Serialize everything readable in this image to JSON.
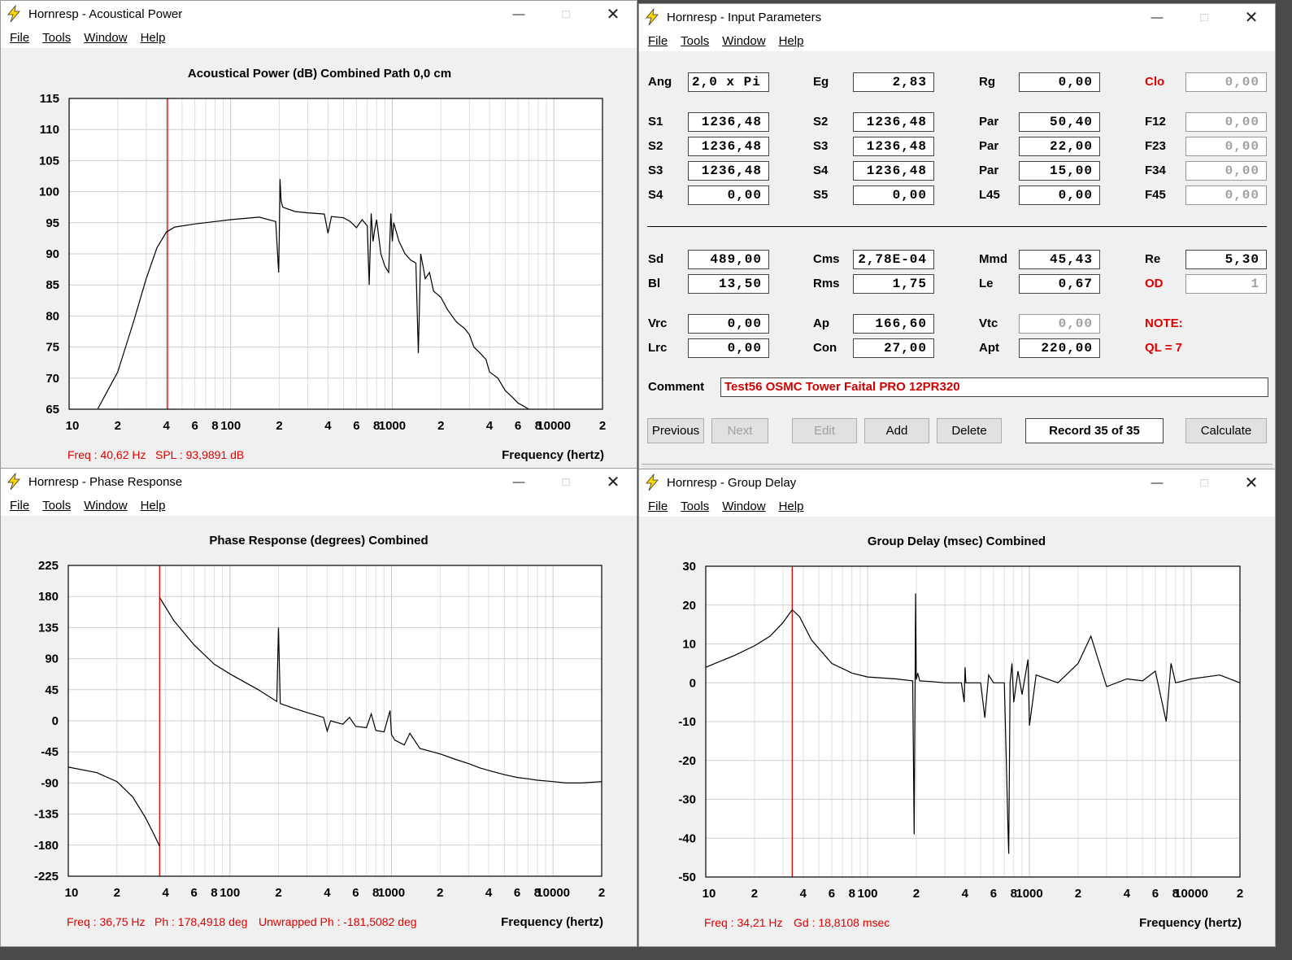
{
  "windows": {
    "ap": {
      "title": "Hornresp - Acoustical Power",
      "menu": [
        "File",
        "Tools",
        "Window",
        "Help"
      ],
      "heading": "Acoustical Power (dB)    Combined    Path 0,0 cm",
      "xlabel": "Frequency (hertz)",
      "status": [
        "Freq : 40,62 Hz",
        "SPL : 93,9891 dB"
      ]
    },
    "ip": {
      "title": "Hornresp - Input Parameters",
      "menu": [
        "File",
        "Tools",
        "Window",
        "Help"
      ]
    },
    "ph": {
      "title": "Hornresp - Phase Response",
      "menu": [
        "File",
        "Tools",
        "Window",
        "Help"
      ],
      "heading": "Phase Response (degrees)    Combined",
      "xlabel": "Frequency (hertz)",
      "status": [
        "Freq : 36,75 Hz",
        "Ph : 178,4918 deg",
        "Unwrapped Ph : -181,5082 deg"
      ]
    },
    "gd": {
      "title": "Hornresp - Group Delay",
      "menu": [
        "File",
        "Tools",
        "Window",
        "Help"
      ],
      "heading": "Group Delay (msec)    Combined",
      "xlabel": "Frequency (hertz)",
      "status": [
        "Freq : 34,21 Hz",
        "Gd : 18,8108 msec"
      ]
    }
  },
  "params": {
    "rows": [
      {
        "cells": [
          [
            "Ang",
            "2,0 x Pi",
            ""
          ],
          [
            "Eg",
            "2,83",
            ""
          ],
          [
            "Rg",
            "0,00",
            ""
          ],
          [
            "Clo",
            "0,00",
            "redgrey"
          ]
        ]
      },
      {
        "cells": [
          [
            "S1",
            "1236,48",
            ""
          ],
          [
            "S2",
            "1236,48",
            ""
          ],
          [
            "Par",
            "50,40",
            ""
          ],
          [
            "F12",
            "0,00",
            "grey"
          ]
        ]
      },
      {
        "cells": [
          [
            "S2",
            "1236,48",
            ""
          ],
          [
            "S3",
            "1236,48",
            ""
          ],
          [
            "Par",
            "22,00",
            ""
          ],
          [
            "F23",
            "0,00",
            "grey"
          ]
        ]
      },
      {
        "cells": [
          [
            "S3",
            "1236,48",
            ""
          ],
          [
            "S4",
            "1236,48",
            ""
          ],
          [
            "Par",
            "15,00",
            ""
          ],
          [
            "F34",
            "0,00",
            "grey"
          ]
        ]
      },
      {
        "cells": [
          [
            "S4",
            "0,00",
            ""
          ],
          [
            "S5",
            "0,00",
            ""
          ],
          [
            "L45",
            "0,00",
            ""
          ],
          [
            "F45",
            "0,00",
            "grey"
          ]
        ]
      },
      {
        "cells": [
          [
            "Sd",
            "489,00",
            ""
          ],
          [
            "Cms",
            "2,78E-04",
            ""
          ],
          [
            "Mmd",
            "45,43",
            ""
          ],
          [
            "Re",
            "5,30",
            ""
          ]
        ]
      },
      {
        "cells": [
          [
            "Bl",
            "13,50",
            ""
          ],
          [
            "Rms",
            "1,75",
            ""
          ],
          [
            "Le",
            "0,67",
            ""
          ],
          [
            "OD",
            "1",
            "redgrey"
          ]
        ]
      },
      {
        "cells": [
          [
            "Vrc",
            "0,00",
            ""
          ],
          [
            "Ap",
            "166,60",
            ""
          ],
          [
            "Vtc",
            "0,00",
            "grey"
          ],
          [
            "NOTE:",
            "",
            "note"
          ]
        ]
      },
      {
        "cells": [
          [
            "Lrc",
            "0,00",
            ""
          ],
          [
            "Con",
            "27,00",
            ""
          ],
          [
            "Apt",
            "220,00",
            ""
          ],
          [
            "QL = 7",
            "",
            "note"
          ]
        ]
      }
    ],
    "comment_label": "Comment",
    "comment_value": "Test56 OSMC Tower Faital PRO 12PR320",
    "buttons": {
      "previous": "Previous",
      "next": "Next",
      "edit": "Edit",
      "add": "Add",
      "delete": "Delete",
      "calculate": "Calculate"
    },
    "record": "Record 35 of 35"
  },
  "freq_ticks": [
    "10",
    "2",
    "4",
    "6",
    "8",
    "100",
    "2",
    "4",
    "6",
    "8",
    "1000",
    "2",
    "4",
    "6",
    "8",
    "10000",
    "2"
  ],
  "chart_data": [
    {
      "type": "line",
      "title": "Acoustical Power (dB)    Combined    Path 0,0 cm",
      "xlabel": "Frequency (hertz)",
      "ylabel": "",
      "xscale": "log",
      "xlim": [
        10,
        20000
      ],
      "ylim": [
        65,
        115
      ],
      "yticks": [
        115,
        110,
        105,
        100,
        95,
        90,
        85,
        80,
        75,
        70,
        65
      ],
      "cursor_freq": 40.62,
      "grid": true,
      "x": [
        15,
        20,
        25,
        30,
        35,
        40,
        45,
        60,
        80,
        100,
        150,
        190,
        198,
        200,
        202,
        205,
        210,
        250,
        300,
        380,
        400,
        420,
        500,
        550,
        600,
        650,
        700,
        720,
        740,
        760,
        780,
        800,
        850,
        900,
        950,
        980,
        1000,
        1020,
        1100,
        1200,
        1300,
        1400,
        1450,
        1500,
        1550,
        1600,
        1700,
        1800,
        2000,
        2200,
        2500,
        2800,
        3000,
        3200,
        3500,
        3800,
        4000,
        4500,
        5000,
        5500,
        6000,
        6500,
        7000
      ],
      "series": [
        {
          "values": [
            65,
            71,
            79,
            86,
            91,
            93.5,
            94.3,
            94.8,
            95.2,
            95.5,
            95.9,
            95.2,
            87,
            93,
            102,
            98.5,
            97.5,
            96.8,
            96.6,
            96.4,
            93.3,
            96.0,
            95.8,
            95.2,
            94.2,
            95.5,
            94.5,
            85,
            96.5,
            92,
            94,
            95.5,
            90,
            88,
            87,
            96.5,
            92,
            95,
            92,
            90,
            89,
            88.5,
            74,
            90,
            88,
            86,
            87,
            84,
            83,
            81,
            79,
            78,
            77,
            75,
            74,
            73,
            71,
            70,
            68,
            67,
            66,
            65.5,
            65
          ]
        }
      ]
    },
    {
      "type": "line",
      "title": "Phase Response (degrees)    Combined",
      "xlabel": "Frequency (hertz)",
      "ylabel": "",
      "xscale": "log",
      "xlim": [
        10,
        20000
      ],
      "ylim": [
        -225,
        225
      ],
      "yticks": [
        225,
        180,
        135,
        90,
        45,
        0,
        -45,
        -90,
        -135,
        -180,
        -225
      ],
      "cursor_freq": 36.75,
      "grid": true,
      "x": [
        10,
        15,
        20,
        25,
        30,
        34,
        36.75,
        36.76,
        45,
        60,
        80,
        100,
        150,
        195,
        200,
        205,
        250,
        300,
        380,
        400,
        420,
        500,
        550,
        600,
        700,
        750,
        800,
        900,
        980,
        1000,
        1050,
        1200,
        1300,
        1500,
        2000,
        2500,
        3000,
        3500,
        4000,
        5000,
        6000,
        7000,
        8000,
        10000,
        12000,
        15000,
        20000
      ],
      "series": [
        {
          "values": [
            -67,
            -75,
            -88,
            -110,
            -140,
            -165,
            -181.5,
            178.5,
            145,
            110,
            82,
            68,
            45,
            28,
            135,
            25,
            18,
            12,
            5,
            -15,
            0,
            -5,
            5,
            -8,
            -10,
            10,
            -14,
            -16,
            15,
            -20,
            -28,
            -35,
            -18,
            -40,
            -48,
            -56,
            -62,
            -68,
            -72,
            -78,
            -82,
            -84,
            -86,
            -88,
            -90,
            -90,
            -88
          ]
        }
      ]
    },
    {
      "type": "line",
      "title": "Group Delay (msec)    Combined",
      "xlabel": "Frequency (hertz)",
      "ylabel": "",
      "xscale": "log",
      "xlim": [
        10,
        20000
      ],
      "ylim": [
        -50,
        30
      ],
      "yticks": [
        30,
        20,
        10,
        0,
        -10,
        -20,
        -30,
        -40,
        -50
      ],
      "cursor_freq": 34.21,
      "grid": true,
      "x": [
        10,
        15,
        20,
        25,
        30,
        34.21,
        38,
        45,
        60,
        80,
        100,
        150,
        190,
        194,
        198,
        200,
        204,
        210,
        250,
        300,
        380,
        395,
        400,
        405,
        500,
        530,
        560,
        600,
        700,
        740,
        745,
        760,
        780,
        800,
        850,
        900,
        980,
        1000,
        1100,
        1500,
        2000,
        2400,
        3000,
        4000,
        5000,
        6000,
        7000,
        7500,
        8000,
        10000,
        15000,
        20000
      ],
      "series": [
        {
          "values": [
            4,
            7,
            9.5,
            12,
            15.5,
            18.8,
            17,
            11,
            5,
            2.5,
            1.5,
            1,
            0.5,
            -39,
            23,
            0.8,
            2.5,
            0.5,
            0.3,
            0,
            0,
            -5,
            4,
            0,
            0,
            -9,
            2,
            0,
            0,
            -40,
            -44,
            0,
            5,
            -5,
            3,
            -3,
            6,
            -11,
            2,
            0,
            5,
            12,
            -1,
            1,
            0.5,
            3,
            -10,
            5,
            0,
            1,
            2,
            0
          ]
        }
      ]
    }
  ]
}
